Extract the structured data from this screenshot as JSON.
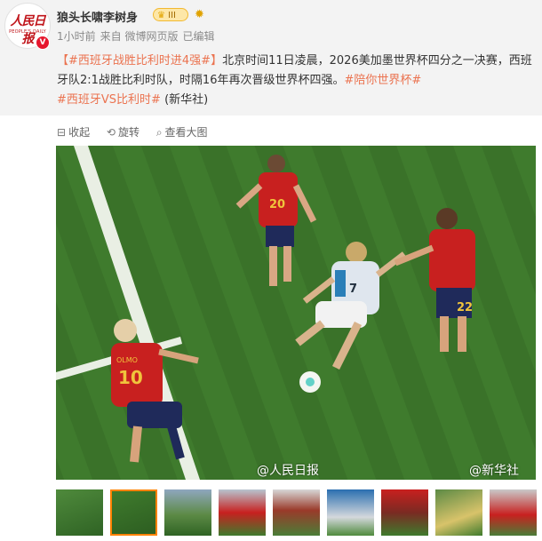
{
  "header": {
    "avatar_logo": "人民日报",
    "avatar_sub": "PEOPLE'S DAILY",
    "verified_badge": "V",
    "username": "狼头长啸李树身",
    "level_badge": "III",
    "level_icon": "crown-icon",
    "sun_icon": "sun-icon",
    "meta": {
      "time": "1小时前",
      "source": "来自 微博网页版",
      "edited": "已编辑"
    }
  },
  "post": {
    "bracket_open": "【",
    "topic_title": "#西班牙战胜比利时进4强#",
    "bracket_close": "】",
    "body": "北京时间11日凌晨，2026美加墨世界杯四分之一决赛，西班牙队2:1战胜比利时队，时隔16年再次晋级世界杯四强。",
    "tag1": "#陪你世界杯#",
    "tag2": "#西班牙VS比利时#",
    "source_note": "(新华社)"
  },
  "actions": [
    {
      "label": "收起",
      "icon": "collapse-icon"
    },
    {
      "label": "旋转",
      "icon": "rotate-icon"
    },
    {
      "label": "查看大图",
      "icon": "magnify-icon"
    }
  ],
  "photo": {
    "watermark_left": "@人民日报",
    "watermark_right": "@新华社",
    "jersey_numbers": [
      "20",
      "7",
      "22",
      "10"
    ],
    "jersey_name": "OLMO"
  },
  "thumbnails": {
    "count": 9,
    "selected_index": 1
  },
  "colors": {
    "accent_link": "#eb7350",
    "header_bg": "#f3f3f3",
    "verified": "#e6162d",
    "spain_red": "#c8201f",
    "pitch_green": "#3e7a2c",
    "thumb_selected": "#ff8200"
  }
}
